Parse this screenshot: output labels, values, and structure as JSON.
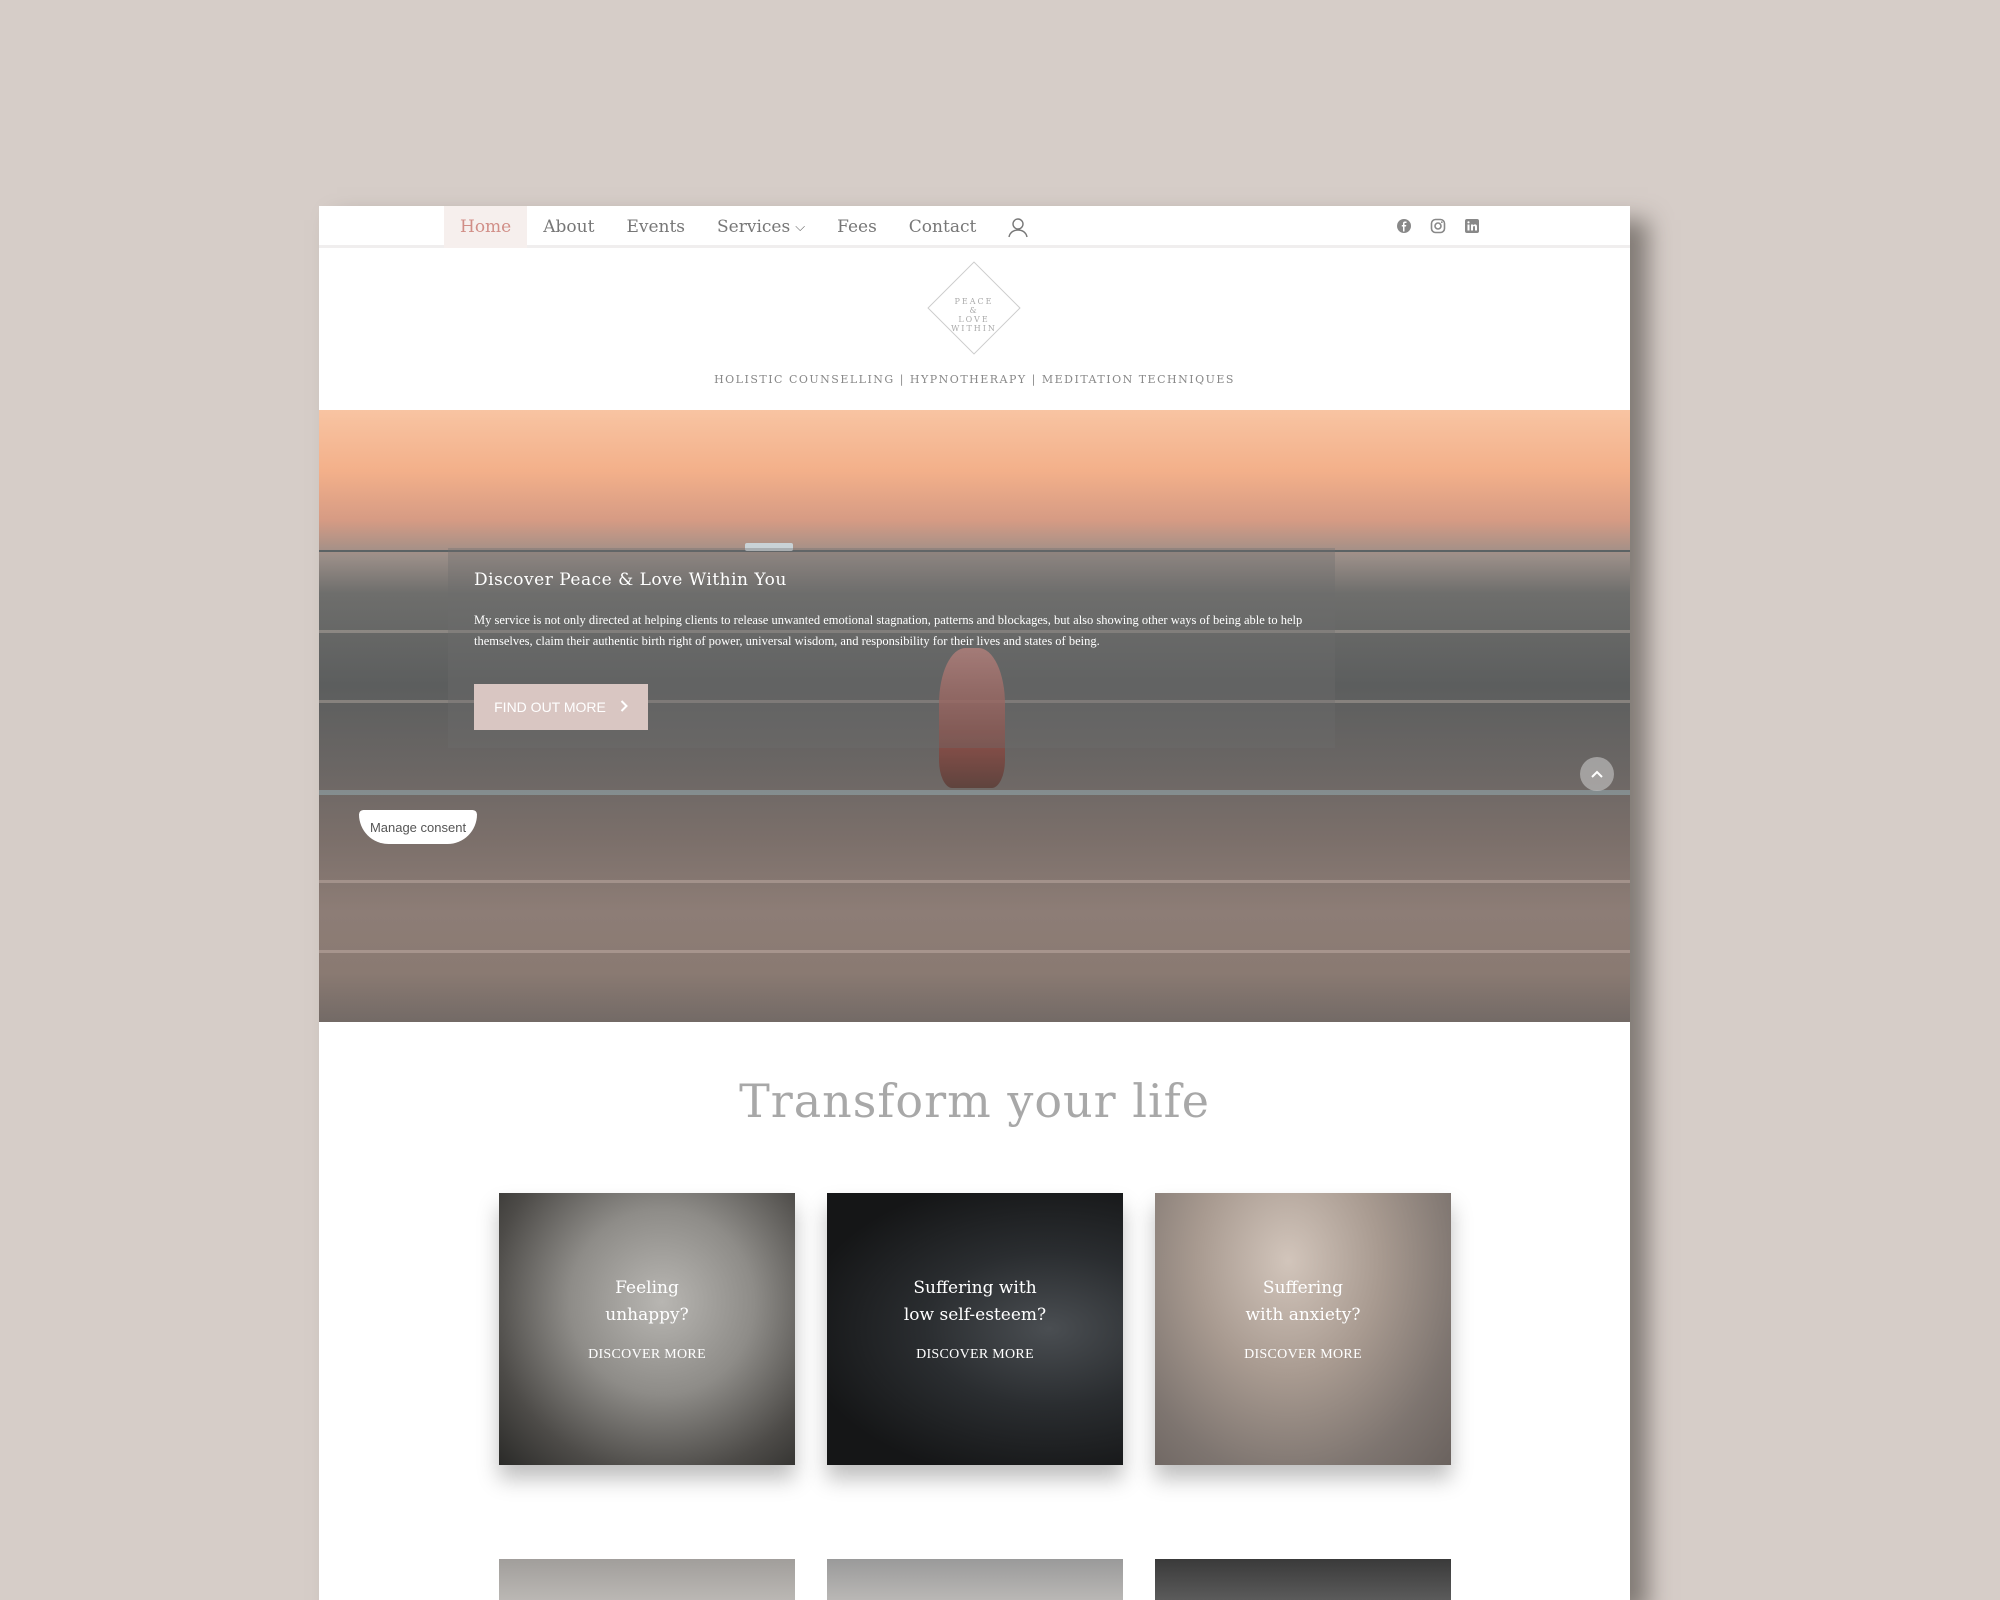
{
  "nav": {
    "items": [
      {
        "label": "Home",
        "active": true
      },
      {
        "label": "About"
      },
      {
        "label": "Events"
      },
      {
        "label": "Services"
      },
      {
        "label": "Fees"
      },
      {
        "label": "Contact"
      }
    ],
    "user_icon": "user-icon",
    "social": [
      "facebook-icon",
      "instagram-icon",
      "linkedin-icon"
    ]
  },
  "header": {
    "logo_lines": [
      "PEACE",
      "&",
      "LOVE",
      "WITHIN"
    ],
    "tagline": "HOLISTIC COUNSELLING | HYPNOTHERAPY | MEDITATION TECHNIQUES"
  },
  "hero": {
    "title": "Discover Peace & Love Within You",
    "body": "My service is not only directed at helping clients to release unwanted emotional stagnation, patterns and blockages, but also showing other ways of being able to help themselves, claim their authentic birth right of power, universal wisdom, and responsibility for their lives and states of being.",
    "cta_label": "FIND OUT MORE"
  },
  "consent": {
    "label": "Manage consent"
  },
  "section": {
    "title": "Transform your life",
    "cards": [
      {
        "line1": "Feeling",
        "line2": "unhappy?",
        "link": "DISCOVER MORE"
      },
      {
        "line1": "Suffering with",
        "line2": "low self-esteem?",
        "link": "DISCOVER MORE"
      },
      {
        "line1": "Suffering",
        "line2": "with anxiety?",
        "link": "DISCOVER MORE"
      }
    ]
  },
  "colors": {
    "background": "#d6cdc8",
    "accent": "#d18e87",
    "cta": "#d9c6c2"
  }
}
